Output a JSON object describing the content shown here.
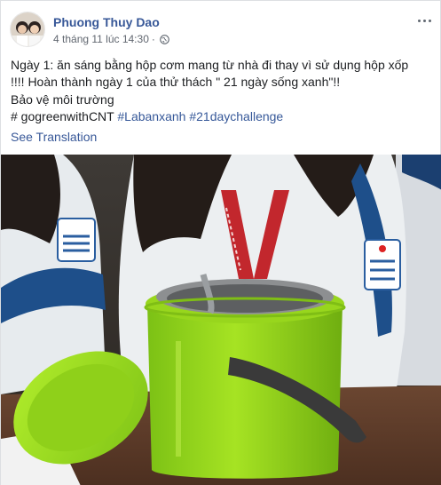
{
  "post": {
    "author": "Phuong Thuy Dao",
    "timestamp": "4 tháng 11 lúc 14:30",
    "privacy_icon": "globe-icon",
    "more_icon": "ellipsis-icon",
    "text_lines": [
      "Ngày 1: ăn sáng bằng hộp cơm mang từ nhà đi thay vì sử dụng hộp xốp",
      "!!!! Hoàn thành ngày 1 của thử thách \" 21 ngày sống xanh\"!!",
      "Bảo vệ môi trường"
    ],
    "hashtag_prefix": "# gogreenwithCNT",
    "hashtags": [
      "#Labanxanh",
      "#21daychallenge"
    ],
    "see_translation": "See Translation"
  },
  "photo": {
    "subject": "green-lunchbox",
    "colors": {
      "lunchbox": "#9ad81a",
      "uniform": "#e8ecef",
      "table": "#5a3b28",
      "lanyard": "#c2272d"
    }
  },
  "colors": {
    "link": "#385898",
    "meta": "#616770",
    "text": "#1c1e21"
  }
}
